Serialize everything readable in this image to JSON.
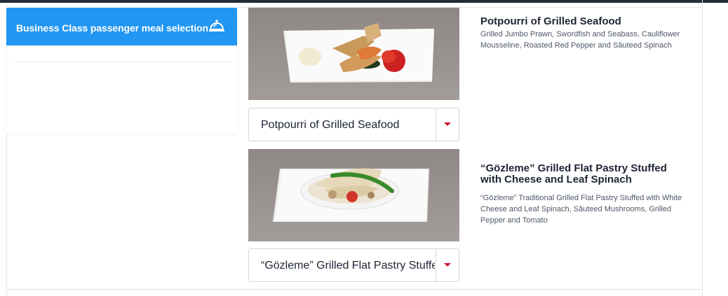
{
  "sidebar": {
    "title": "Business Class passenger meal selection",
    "icon": "cloche-icon",
    "accent": "#2196f3"
  },
  "meals": [
    {
      "title": "Potpourri of Grilled Seafood",
      "description": "Grilled Jumbo Prawn, Swordfish and Seabass, Cauliflower Mousseline, Roasted Red Pepper and Sâuteed Spinach",
      "selected": "Potpourri of Grilled Seafood"
    },
    {
      "title": "“Gözleme” Grilled Flat Pastry Stuffed with Cheese and Leaf Spinach",
      "description": "“Gözleme” Traditional Grilled Flat Pastry Stuffed with White Cheese and Leaf Spinach, Sâuteed Mushrooms, Grilled Pepper and Tomato",
      "selected": "“Gözleme” Grilled Flat Pastry Stuffed with Cheese and Leaf Spinach"
    }
  ],
  "colors": {
    "caret": "#c8102e",
    "header_bg": "#2196f3"
  }
}
